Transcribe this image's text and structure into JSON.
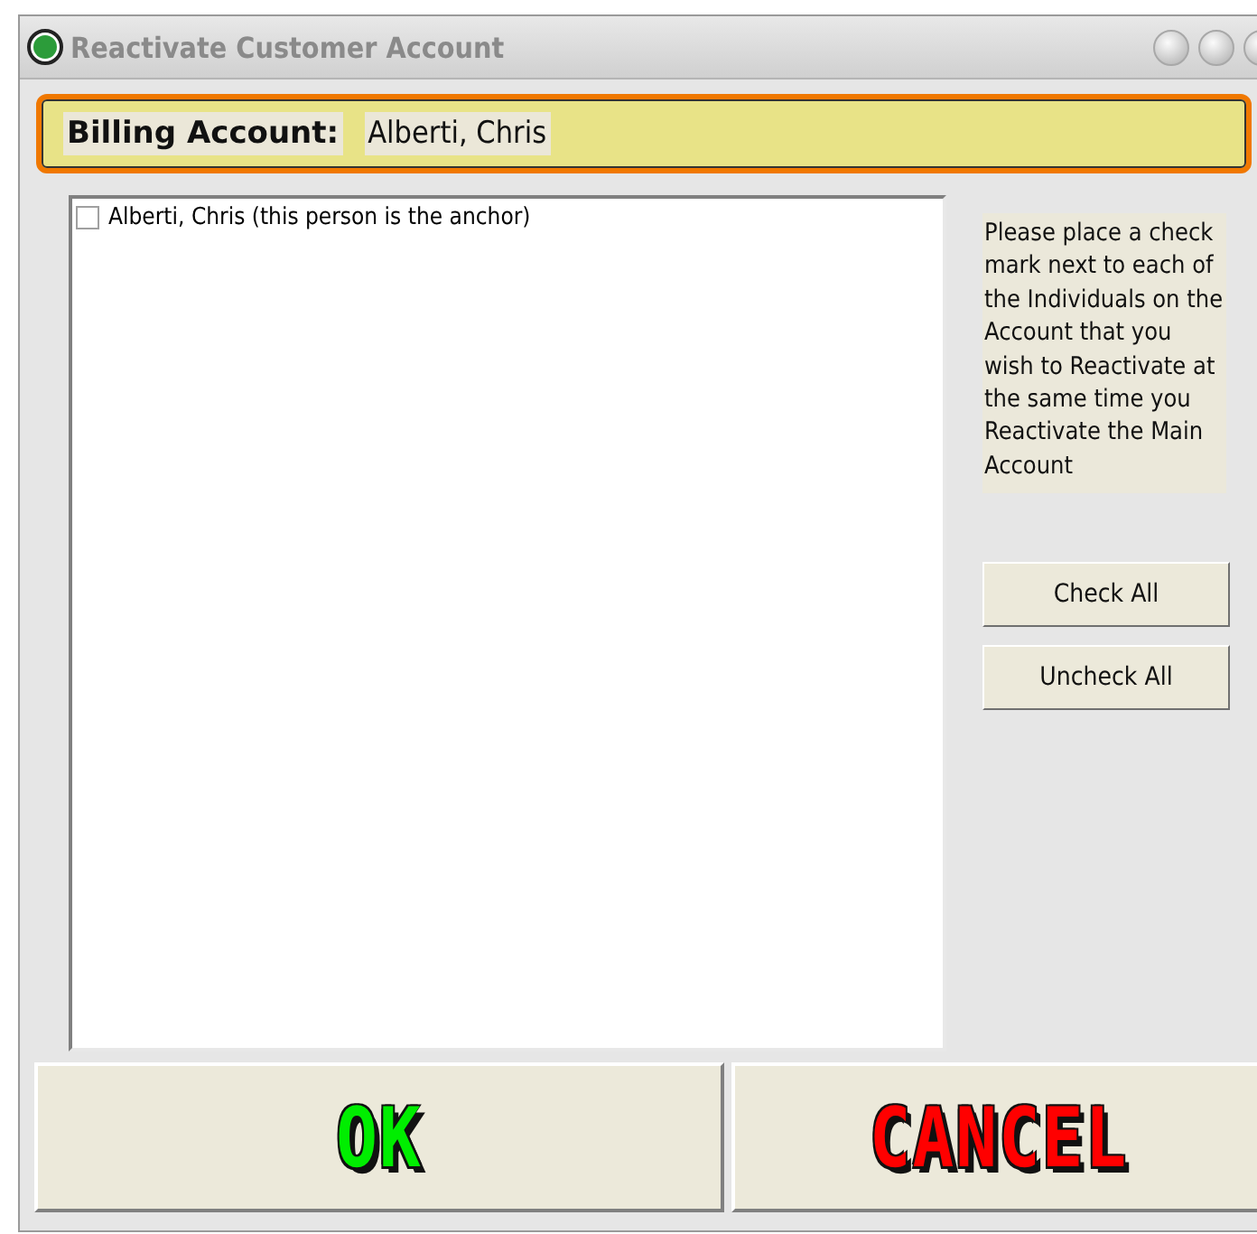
{
  "window": {
    "title": "Reactivate Customer Account"
  },
  "billing": {
    "label": "Billing Account:",
    "value": "Alberti, Chris"
  },
  "individuals": [
    {
      "label": "Alberti, Chris (this person is the anchor)",
      "checked": false
    }
  ],
  "instructions": "Please place a check mark next to each of the Individuals on the Account that you wish to Reactivate at the same time you Reactivate the Main Account",
  "side_buttons": [
    "Check All",
    "Uncheck All"
  ],
  "buttons": [
    {
      "label": "OK",
      "kind": "ok"
    },
    {
      "label": "CANCEL",
      "kind": "cancel"
    }
  ]
}
